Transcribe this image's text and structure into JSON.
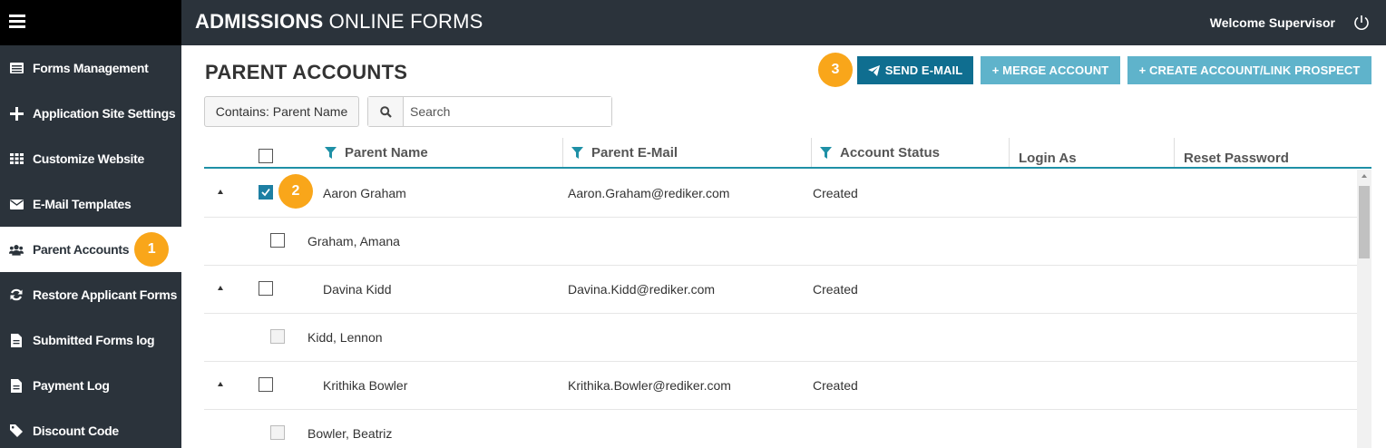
{
  "header": {
    "title_bold": "ADMISSIONS",
    "title_rest": " ONLINE FORMS",
    "welcome": "Welcome Supervisor"
  },
  "sidebar": {
    "items": [
      {
        "label": "Forms Management",
        "icon": "list-icon"
      },
      {
        "label": "Application Site Settings",
        "icon": "plus-icon"
      },
      {
        "label": "Customize Website",
        "icon": "grid-icon"
      },
      {
        "label": "E-Mail Templates",
        "icon": "envelope-icon"
      },
      {
        "label": "Parent Accounts",
        "icon": "users-icon",
        "active": true
      },
      {
        "label": "Restore Applicant Forms",
        "icon": "refresh-icon"
      },
      {
        "label": "Submitted Forms log",
        "icon": "document-icon"
      },
      {
        "label": "Payment Log",
        "icon": "document-icon"
      },
      {
        "label": "Discount Code",
        "icon": "tag-icon"
      }
    ]
  },
  "page": {
    "title": "PARENT ACCOUNTS",
    "send_email": "SEND E-MAIL",
    "merge_account": "+ MERGE ACCOUNT",
    "create_account": "+ CREATE ACCOUNT/LINK PROSPECT",
    "filter_label": "Contains: Parent Name",
    "search_placeholder": "Search"
  },
  "grid": {
    "columns": [
      "Parent Name",
      "Parent E-Mail",
      "Account Status",
      "Login As",
      "Reset Password"
    ],
    "rows": [
      {
        "type": "parent",
        "name": "Aaron Graham",
        "email": "Aaron.Graham@rediker.com",
        "status": "Created",
        "checked": true
      },
      {
        "type": "child",
        "name": "Graham, Amana",
        "disabled": false
      },
      {
        "type": "parent",
        "name": "Davina Kidd",
        "email": "Davina.Kidd@rediker.com",
        "status": "Created",
        "checked": false
      },
      {
        "type": "child",
        "name": "Kidd, Lennon",
        "disabled": true
      },
      {
        "type": "parent",
        "name": "Krithika Bowler",
        "email": "Krithika.Bowler@rediker.com",
        "status": "Created",
        "checked": false
      },
      {
        "type": "child",
        "name": "Bowler, Beatriz",
        "disabled": true
      }
    ]
  },
  "callouts": [
    "1",
    "2",
    "3"
  ],
  "colors": {
    "sidebar": "#2b333b",
    "accent": "#1e90a6",
    "send_button": "#0f6e90",
    "secondary_button": "#5fb3cb",
    "callout": "#f9a61a"
  }
}
